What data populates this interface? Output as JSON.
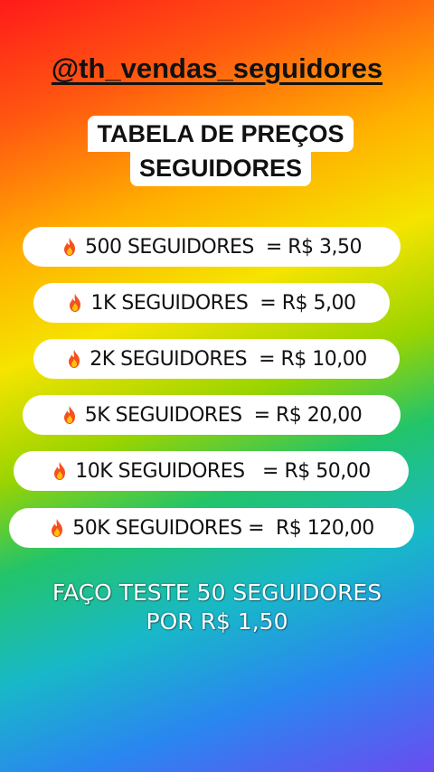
{
  "handle": "@th_vendas_seguidores",
  "title": {
    "line1": "TABELA DE PREÇOS",
    "line2": "SEGUIDORES"
  },
  "price_rows": [
    {
      "icon": "fire-icon",
      "text": "500 SEGUIDORES  = R$ 3,50"
    },
    {
      "icon": "fire-icon",
      "text": "1K SEGUIDORES  = R$ 5,00"
    },
    {
      "icon": "fire-icon",
      "text": "2K SEGUIDORES  = R$ 10,00"
    },
    {
      "icon": "fire-icon",
      "text": "5K SEGUIDORES  = R$ 20,00"
    },
    {
      "icon": "fire-icon",
      "text": "10K SEGUIDORES   = R$ 50,00"
    },
    {
      "icon": "fire-icon",
      "text": "50K SEGUIDORES =  R$ 120,00"
    }
  ],
  "footer": {
    "line1": "FAÇO TESTE 50 SEGUIDORES",
    "line2": "POR R$ 1,50"
  },
  "colors": {
    "row_background": "#ffffff",
    "text": "#111111",
    "footer_text": "#ffffff",
    "fire_outer": "#f4511e",
    "fire_inner": "#ffc107"
  }
}
